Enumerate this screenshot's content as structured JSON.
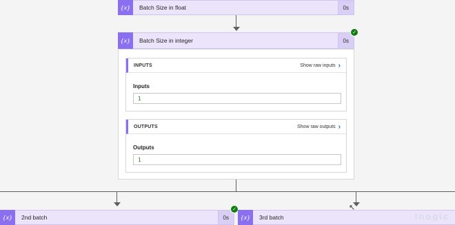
{
  "steps": {
    "float": {
      "title": "Batch Size in float",
      "duration": "0s"
    },
    "integer": {
      "title": "Batch Size in integer",
      "duration": "0s",
      "inputs_section": {
        "heading": "INPUTS",
        "raw_link": "Show raw inputs",
        "field_label": "Inputs",
        "value": "1"
      },
      "outputs_section": {
        "heading": "OUTPUTS",
        "raw_link": "Show raw outputs",
        "field_label": "Outputs",
        "value": "1"
      }
    },
    "second": {
      "title": "2nd batch",
      "duration": "0s"
    },
    "third": {
      "title": "3rd batch"
    }
  },
  "icons": {
    "action": "variable-expression-icon",
    "status": "success-check-icon"
  },
  "watermark": "Inogic",
  "colors": {
    "accent": "#8a6ff0",
    "header_bg": "#ebe4fb",
    "success": "#107c10",
    "link": "#0f6cbd"
  }
}
